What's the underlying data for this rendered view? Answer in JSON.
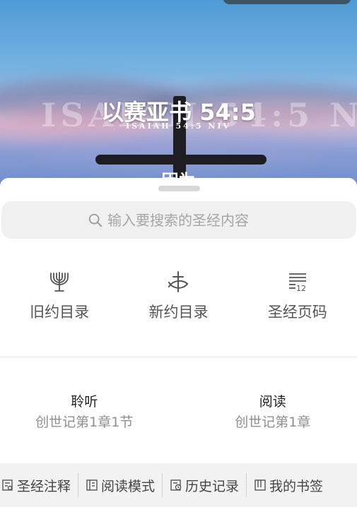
{
  "hero": {
    "title": "以赛亚书 54:5",
    "subtitle": "ISAIAH 54:5 NIV",
    "watermark": "ISAIAH 54:5 NIV",
    "peek_text": "因为"
  },
  "search": {
    "placeholder": "输入要搜索的圣经内容"
  },
  "quick_nav": [
    {
      "label": "旧约目录",
      "icon": "menorah-icon"
    },
    {
      "label": "新约目录",
      "icon": "cross-fish-icon"
    },
    {
      "label": "圣经页码",
      "icon": "page-number-icon"
    }
  ],
  "continue": {
    "listen": {
      "title": "聆听",
      "progress": "创世记第1章1节"
    },
    "read": {
      "title": "阅读",
      "progress": "创世记第1章"
    }
  },
  "bottom_bar": [
    {
      "label": "圣经注释",
      "icon": "annotation-icon"
    },
    {
      "label": "阅读模式",
      "icon": "book-icon"
    },
    {
      "label": "历史记录",
      "icon": "history-icon"
    },
    {
      "label": "我的书签",
      "icon": "bookmark-icon"
    }
  ],
  "colors": {
    "sky_top": "#4f9bd7",
    "sheet_bg": "#ffffff",
    "search_bg": "#f0f0f0",
    "bottom_bar_bg": "#f2f2f2"
  }
}
